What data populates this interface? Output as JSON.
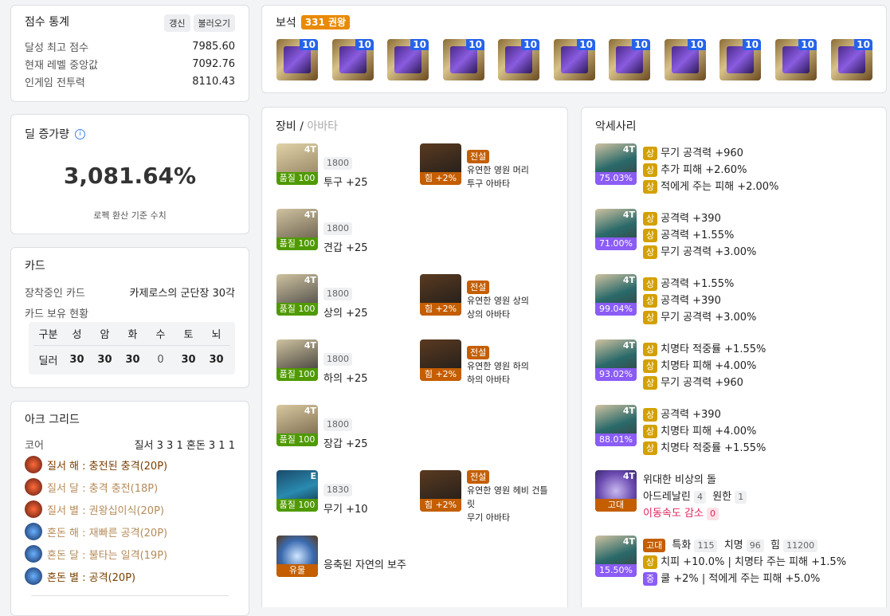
{
  "score": {
    "title": "점수 통계",
    "refresh_label": "갱신",
    "load_label": "불러오기",
    "rows": [
      {
        "label": "달성 최고 점수",
        "value": "7985.60"
      },
      {
        "label": "현재 레벨 중앙값",
        "value": "7092.76"
      },
      {
        "label": "인게임 전투력",
        "value": "8110.43"
      }
    ]
  },
  "damage": {
    "title": "딜 증가량",
    "value": "3,081.64%",
    "note": "로펙 환산 기준 수치"
  },
  "cards": {
    "title": "카드",
    "equipped_label": "장착중인 카드",
    "equipped_value": "카제로스의 군단장 30각",
    "owned_label": "카드 보유 현황",
    "headers": [
      "구분",
      "성",
      "암",
      "화",
      "수",
      "토",
      "뇌"
    ],
    "row": [
      "딜러",
      "30",
      "30",
      "30",
      "0",
      "30",
      "30"
    ]
  },
  "ark": {
    "title": "아크 그리드",
    "core_label": "코어",
    "core_value": "질서 3 3 1 혼돈 3 1 1",
    "items": [
      {
        "text": "질서 해 : 충전된 충격(20P)",
        "color": "#7a3e00"
      },
      {
        "text": "질서 달 : 충격 충전(18P)",
        "color": "#b58b5a"
      },
      {
        "text": "질서 별 : 권왕십이식(20P)",
        "color": "#b58b5a"
      },
      {
        "text": "혼돈 해 : 재빠른 공격(20P)",
        "color": "#b58b5a"
      },
      {
        "text": "혼돈 달 : 불타는 일격(19P)",
        "color": "#b58b5a"
      },
      {
        "text": "혼돈 별 : 공격(20P)",
        "color": "#7a3e00"
      }
    ]
  },
  "gems": {
    "title": "보석",
    "badge": "331 권왕",
    "levels": [
      "10",
      "10",
      "10",
      "10",
      "10",
      "10",
      "10",
      "10",
      "10",
      "10",
      "10"
    ]
  },
  "equipment": {
    "title": "장비",
    "sep": " / ",
    "avatar_tab": "아바타",
    "items": [
      {
        "tier": "4T",
        "quality": "품질 100",
        "ilvl": "1800",
        "name": "투구 +25"
      },
      {
        "tier": "4T",
        "quality": "품질 100",
        "ilvl": "1800",
        "name": "견갑 +25"
      },
      {
        "tier": "4T",
        "quality": "품질 100",
        "ilvl": "1800",
        "name": "상의 +25"
      },
      {
        "tier": "4T",
        "quality": "품질 100",
        "ilvl": "1800",
        "name": "하의 +25"
      },
      {
        "tier": "4T",
        "quality": "품질 100",
        "ilvl": "1800",
        "name": "장갑 +25"
      },
      {
        "tier": "E",
        "quality": "품질 100",
        "ilvl": "1830",
        "name": "무기 +10"
      }
    ],
    "avatars": [
      {
        "grade": "전설",
        "stat": "힘 +2%",
        "line1": "유연한 영원 머리",
        "line2": "투구 아바타"
      },
      {
        "grade": "전설",
        "stat": "힘 +2%",
        "line1": "유연한 영원 상의",
        "line2": "상의 아바타"
      },
      {
        "grade": "전설",
        "stat": "힘 +2%",
        "line1": "유연한 영원 하의",
        "line2": "하의 아바타"
      },
      {
        "grade": "전설",
        "stat": "힘 +2%",
        "line1": "유연한 영원 헤비 건틀",
        "line1b": "릿",
        "line2": "무기 아바타"
      }
    ],
    "relic": {
      "label": "유물",
      "name": "응축된 자연의 보주"
    }
  },
  "accessories": {
    "title": "악세사리",
    "items": [
      {
        "tier": "4T",
        "pct": "75.03%",
        "lines": [
          {
            "g": "상",
            "t": "무기 공격력 +960"
          },
          {
            "g": "상",
            "t": "추가 피해 +2.60%"
          },
          {
            "g": "상",
            "t": "적에게 주는 피해 +2.00%"
          }
        ]
      },
      {
        "tier": "4T",
        "pct": "71.00%",
        "lines": [
          {
            "g": "상",
            "t": "공격력 +390"
          },
          {
            "g": "상",
            "t": "공격력 +1.55%"
          },
          {
            "g": "상",
            "t": "무기 공격력 +3.00%"
          }
        ]
      },
      {
        "tier": "4T",
        "pct": "99.04%",
        "lines": [
          {
            "g": "상",
            "t": "공격력 +1.55%"
          },
          {
            "g": "상",
            "t": "공격력 +390"
          },
          {
            "g": "상",
            "t": "무기 공격력 +3.00%"
          }
        ]
      },
      {
        "tier": "4T",
        "pct": "93.02%",
        "lines": [
          {
            "g": "상",
            "t": "치명타 적중률 +1.55%"
          },
          {
            "g": "상",
            "t": "치명타 피해 +4.00%"
          },
          {
            "g": "상",
            "t": "무기 공격력 +960"
          }
        ]
      },
      {
        "tier": "4T",
        "pct": "88.01%",
        "lines": [
          {
            "g": "상",
            "t": "공격력 +390"
          },
          {
            "g": "상",
            "t": "치명타 피해 +4.00%"
          },
          {
            "g": "상",
            "t": "치명타 적중률 +1.55%"
          }
        ]
      }
    ],
    "stone": {
      "tier": "4T",
      "label": "고대",
      "name": "위대한 비상의 돌",
      "eng1": "아드레날린",
      "eng1v": "4",
      "eng2": "원한",
      "eng2v": "1",
      "neg": "이동속도 감소",
      "negv": "0"
    },
    "bracelet": {
      "tier": "4T",
      "pct": "15.50%",
      "grade": "고대",
      "s1": "특화",
      "s1v": "115",
      "s2": "치명",
      "s2v": "96",
      "s3": "힘",
      "s3v": "11200",
      "line2g": "상",
      "line2": "치피 +10.0% | 치명타 주는 피해 +1.5%",
      "line3g": "중",
      "line3": "쿨 +2% | 적에게 주는 피해 +5.0%"
    }
  },
  "colors": {
    "legend": "#c45e00",
    "quality": "#4f9a00",
    "pct": "#8b5cf6",
    "gem_badge": "#e98a00"
  }
}
